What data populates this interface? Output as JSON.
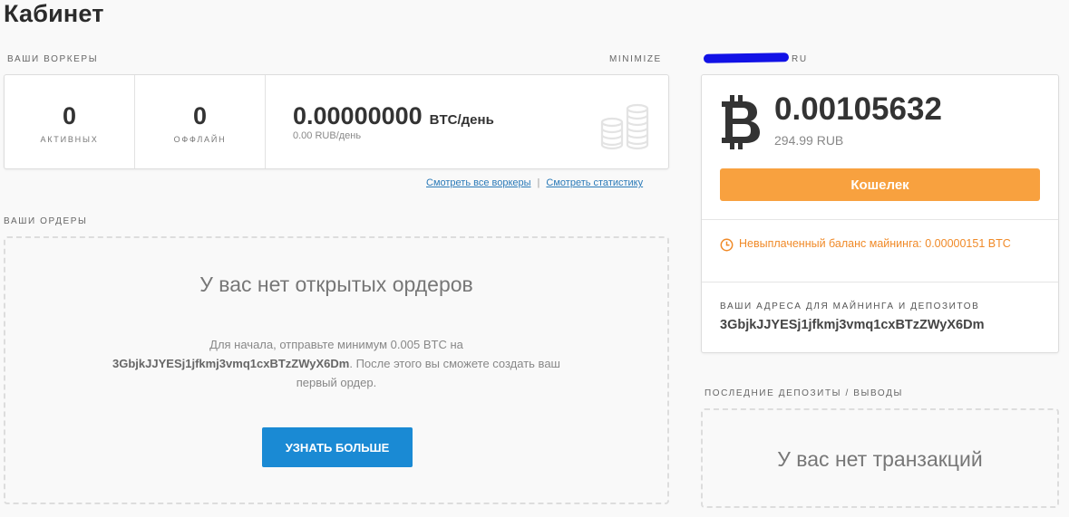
{
  "page": {
    "title": "Кабинет"
  },
  "workers": {
    "section_label": "ВАШИ ВОРКЕРЫ",
    "minimize": "MINIMIZE",
    "active_count": "0",
    "active_label": "АКТИВНЫХ",
    "offline_count": "0",
    "offline_label": "ОФФЛАЙН",
    "earnings_value": "0.00000000",
    "earnings_unit": "BTC/день",
    "earnings_rub": "0.00 RUB/день",
    "link_all_workers": "Смотреть все воркеры",
    "link_separator": "|",
    "link_statistics": "Смотреть статистику"
  },
  "orders": {
    "section_label": "ВАШИ ОРДЕРЫ",
    "empty_title": "У вас нет открытых ордеров",
    "hint_prefix": "Для начала, отправьте минимум 0.005 BTC на",
    "hint_address": "3GbjkJJYESj1jfkmj3vmq1cxBTzZWyX6Dm",
    "hint_suffix": ". После этого вы сможете создать ваш первый ордер.",
    "learn_more_button": "УЗНАТЬ БОЛЬШЕ"
  },
  "account": {
    "label_suffix": "RU",
    "redaction_color": "#1212e6",
    "balance_btc": "0.00105632",
    "balance_rub": "294.99 RUB",
    "wallet_button": "Кошелек",
    "unpaid_text": "Невыплаченный баланс майнинга: 0.00000151 BTC",
    "address_label": "ВАШИ АДРЕСА ДЛЯ МАЙНИНГА И ДЕПОЗИТОВ",
    "address_value": "3GbjkJJYESj1jfkmj3vmq1cxBTzZWyX6Dm"
  },
  "deposits": {
    "section_label": "ПОСЛЕДНИЕ ДЕПОЗИТЫ / ВЫВОДЫ",
    "empty_text": "У вас нет транзакций"
  },
  "colors": {
    "accent_blue": "#1a8ad4",
    "wallet_orange": "#f8a13f",
    "warning_orange": "#f08a28",
    "link_blue": "#2a7ab8"
  },
  "icons": {
    "coins": "coins-stack-icon",
    "bitcoin": "bitcoin-icon",
    "clock": "clock-icon"
  }
}
